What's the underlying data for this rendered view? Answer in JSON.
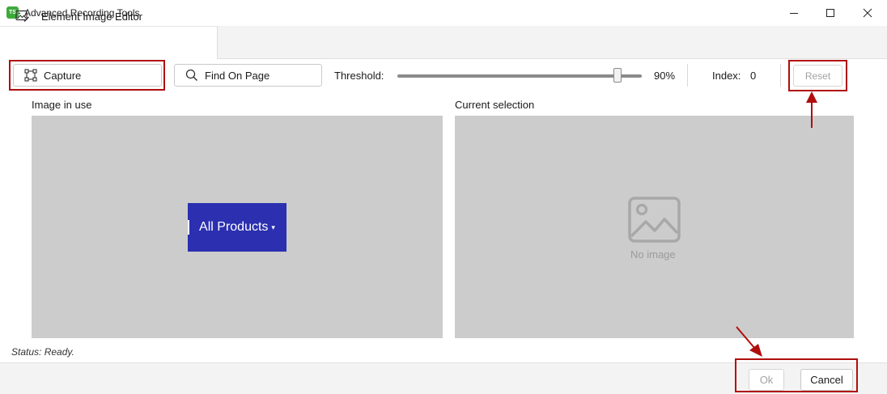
{
  "window": {
    "app_icon_text": "TS",
    "title": "Advanced Recording Tools"
  },
  "tab": {
    "label": "Element Image Editor",
    "icon": "image-edit-icon"
  },
  "toolbar": {
    "capture_label": "Capture",
    "find_label": "Find On Page",
    "threshold_label": "Threshold:",
    "threshold_value": "90%",
    "threshold_fraction": 0.9,
    "index_label": "Index:",
    "index_value": "0",
    "reset_label": "Reset"
  },
  "panels": {
    "left_label": "Image in use",
    "right_label": "Current selection",
    "captured_text": "All Products",
    "captured_caret": "▾",
    "no_image_text": "No image"
  },
  "status": "Status: Ready.",
  "footer": {
    "ok_label": "Ok",
    "cancel_label": "Cancel"
  },
  "colors": {
    "annotation_red": "#b00d0d",
    "captured_bg": "#2b2fb0",
    "panel_bg": "#cccccc",
    "app_icon_green": "#3dab3a"
  }
}
